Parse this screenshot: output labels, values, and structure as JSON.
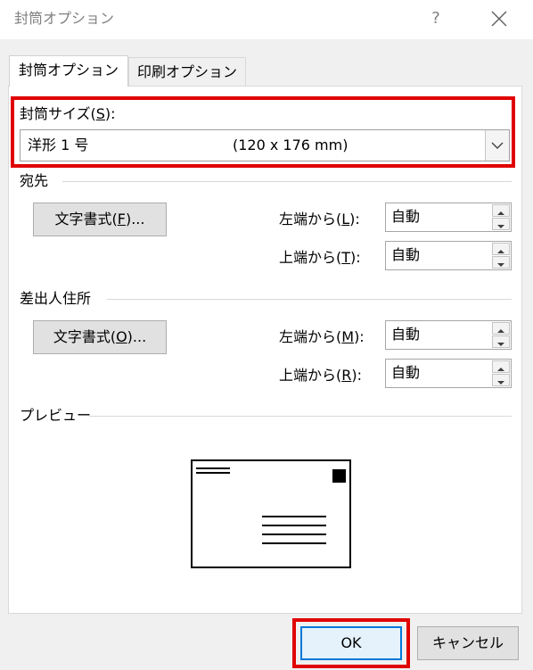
{
  "window": {
    "title": "封筒オプション",
    "help_label": "?",
    "close_icon": "close-icon"
  },
  "tabs": [
    {
      "label": "封筒オプション",
      "active": true
    },
    {
      "label": "印刷オプション",
      "active": false
    }
  ],
  "envelope_size": {
    "label_prefix": "封筒サイズ(",
    "label_key": "S",
    "label_suffix": "):",
    "selected_name": "洋形 1 号",
    "selected_dims": "(120 x 176 mm)"
  },
  "delivery_address": {
    "header": "宛先",
    "font_button": {
      "prefix": "文字書式(",
      "key": "F",
      "suffix": ")..."
    },
    "left_label": {
      "prefix": "左端から(",
      "key": "L",
      "suffix": "):"
    },
    "left_value": "自動",
    "top_label": {
      "prefix": "上端から(",
      "key": "T",
      "suffix": "):"
    },
    "top_value": "自動"
  },
  "return_address": {
    "header": "差出人住所",
    "font_button": {
      "prefix": "文字書式(",
      "key": "O",
      "suffix": ")..."
    },
    "left_label": {
      "prefix": "左端から(",
      "key": "M",
      "suffix": "):"
    },
    "left_value": "自動",
    "top_label": {
      "prefix": "上端から(",
      "key": "R",
      "suffix": "):"
    },
    "top_value": "自動"
  },
  "preview": {
    "header": "プレビュー"
  },
  "buttons": {
    "ok": "OK",
    "cancel": "キャンセル"
  },
  "colors": {
    "highlight": "#e00000",
    "ok_border": "#0078d7"
  }
}
